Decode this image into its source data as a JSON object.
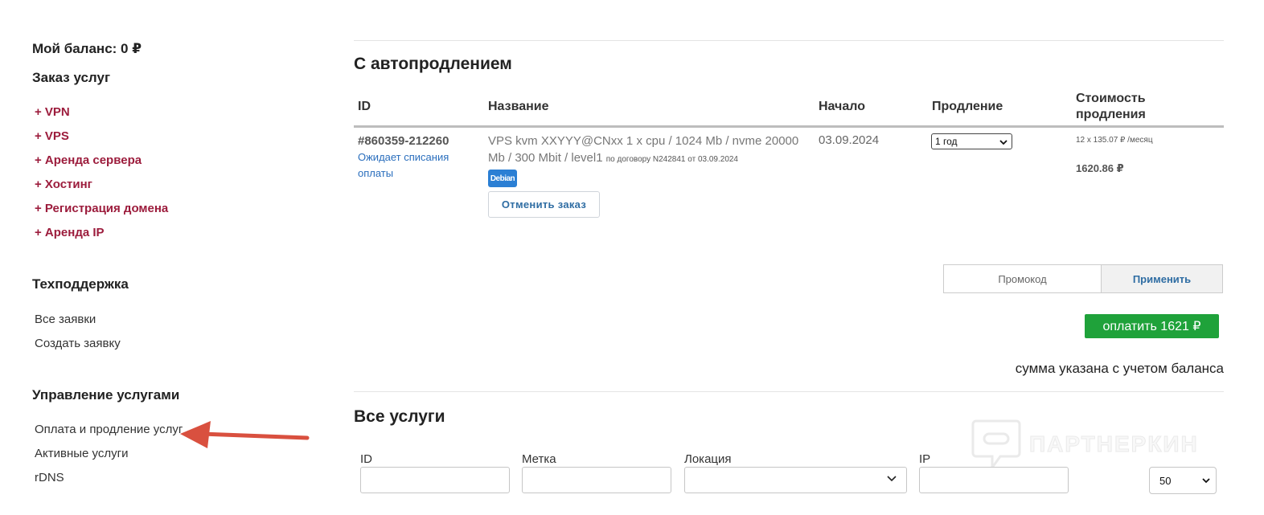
{
  "sidebar": {
    "balance": "Мой баланс: 0 ₽",
    "order_heading": "Заказ услуг",
    "order_items": [
      "+ VPN",
      "+ VPS",
      "+ Аренда сервера",
      "+ Хостинг",
      "+ Регистрация домена",
      "+ Аренда IP"
    ],
    "support_heading": "Техподдержка",
    "support_items": [
      "Все заявки",
      "Создать заявку"
    ],
    "manage_heading": "Управление услугами",
    "manage_items": [
      "Оплата и продление услуг",
      "Активные услуги",
      "rDNS"
    ]
  },
  "autorenew": {
    "heading": "С автопродлением",
    "columns": {
      "id": "ID",
      "name": "Название",
      "start": "Начало",
      "renew": "Продление",
      "cost": "Стоимость продления"
    },
    "order": {
      "id": "#860359-212260",
      "status": "Ожидает списания оплаты",
      "name": "VPS kvm XXYYY@CNxx 1 x cpu / 1024 Mb / nvme 20000 Mb / 300 Mbit / level1",
      "contract": "по договору N242841 от 03.09.2024",
      "os_badge": "Debian",
      "cancel_label": "Отменить заказ",
      "start_date": "03.09.2024",
      "renew_period": "1 год",
      "cost_per_month": "12 x 135.07 ₽ /месяц",
      "cost_total": "1620.86 ₽"
    },
    "promo_placeholder": "Промокод",
    "promo_apply": "Применить",
    "pay_label": "оплатить 1621 ₽",
    "balance_note": "сумма указана с учетом баланса"
  },
  "all_services": {
    "heading": "Все услуги",
    "filters": {
      "id_label": "ID",
      "tag_label": "Метка",
      "location_label": "Локация",
      "ip_label": "IP",
      "per_page": "50"
    }
  },
  "watermark": {
    "text": "ПАРТНЕРКИН",
    "icon": "chat-bubble-logo-icon"
  },
  "annotation": {
    "arrow_color": "#d9503f"
  },
  "colors": {
    "order_link": "#9c1c3c",
    "link_blue": "#2a6ebd",
    "pay_green": "#1fa23a",
    "badge_blue": "#2b7fd4"
  }
}
